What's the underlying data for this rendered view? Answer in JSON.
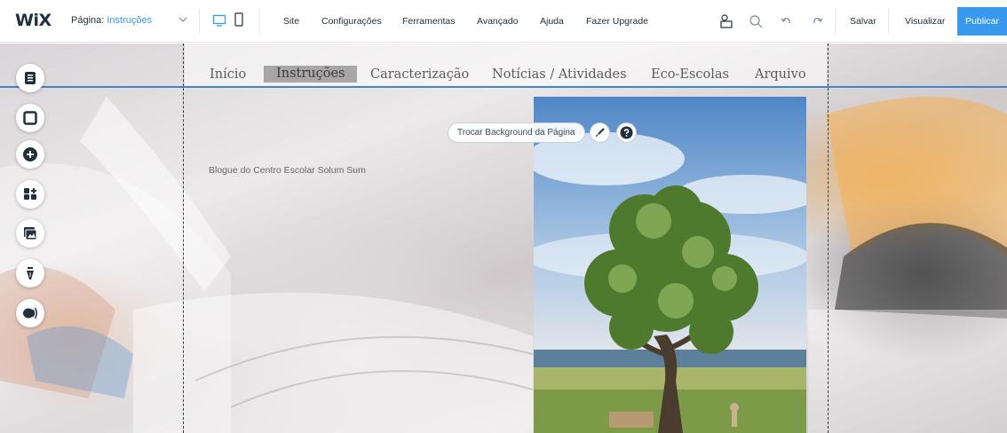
{
  "editor": {
    "logo": "WiX",
    "page_label": "Página:",
    "page_value": "Instruções",
    "menu": [
      "Site",
      "Configurações",
      "Ferramentas",
      "Avançado",
      "Ajuda",
      "Fazer Upgrade"
    ],
    "actions": {
      "save": "Salvar",
      "preview": "Visualizar",
      "publish": "Publicar"
    },
    "accent_color": "#3899ec"
  },
  "site": {
    "nav": [
      "Início",
      "Instruções",
      "Caracterização",
      "Notícias / Atividades",
      "Eco-Escolas",
      "Arquivo"
    ],
    "active_nav": "Instruções",
    "change_background": "Trocar Background da Página",
    "blog_text": "Blogue do Centro Escolar Solum Sum"
  },
  "icons": {
    "rail": [
      "pages-icon",
      "background-icon",
      "add-icon",
      "app-market-icon",
      "media-icon",
      "blog-icon",
      "contact-icon"
    ],
    "toolbar": [
      "desktop-icon",
      "mobile-icon",
      "layers-icon",
      "zoom-icon",
      "undo-icon",
      "redo-icon"
    ]
  }
}
